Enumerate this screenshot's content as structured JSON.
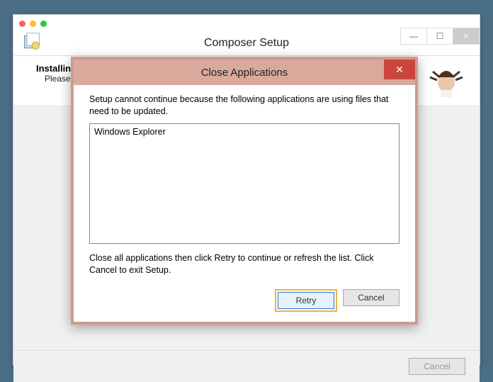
{
  "outer": {
    "title": "Composer Setup",
    "heading": "Installing",
    "subheading": "Please wait while Setup installs Composer on your computer.",
    "footer_cancel": "Cancel"
  },
  "modal": {
    "title": "Close Applications",
    "message": "Setup cannot continue because the following applications are using files that need to be updated.",
    "apps": [
      "Windows Explorer"
    ],
    "hint": "Close all applications then click Retry to continue or refresh the list. Click Cancel to exit Setup.",
    "retry": "Retry",
    "cancel": "Cancel"
  }
}
